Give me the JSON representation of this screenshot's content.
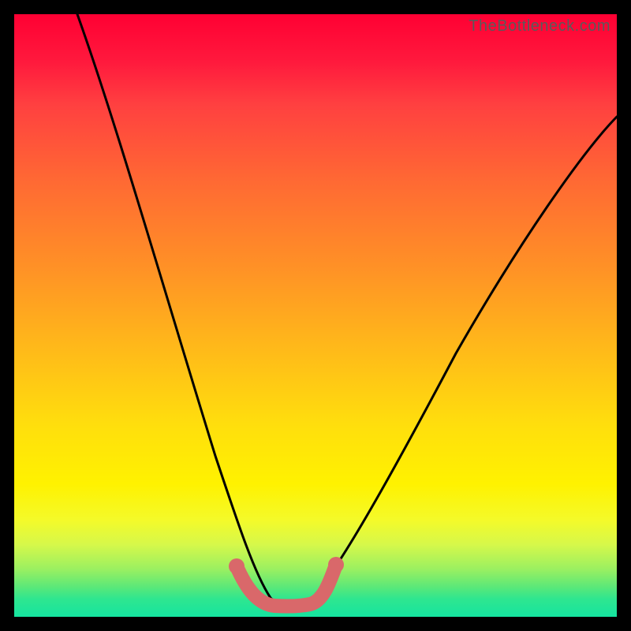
{
  "watermark": "TheBottleneck.com",
  "chart_data": {
    "type": "line",
    "title": "",
    "xlabel": "",
    "ylabel": "",
    "xlim": [
      0,
      100
    ],
    "ylim": [
      0,
      100
    ],
    "series": [
      {
        "name": "bottleneck-curve",
        "x": [
          0,
          6,
          12,
          18,
          24,
          28,
          32,
          35,
          37,
          39,
          41,
          43,
          45,
          47,
          50,
          54,
          58,
          62,
          66,
          72,
          80,
          90,
          100
        ],
        "values": [
          100,
          92,
          82,
          71,
          58,
          47,
          35,
          24,
          15,
          8,
          3,
          1,
          1,
          1,
          3,
          8,
          15,
          23,
          31,
          42,
          55,
          67,
          75
        ]
      },
      {
        "name": "optimal-band",
        "x": [
          37,
          38,
          39,
          40,
          41,
          42,
          43,
          44,
          45,
          46,
          47,
          48,
          49
        ],
        "values": [
          7,
          4,
          2,
          1,
          1,
          1,
          1,
          1,
          1,
          1,
          2,
          4,
          7
        ]
      }
    ],
    "gradient_description": "vertical red-to-green heatmap background; curve dips to green zone near x≈43"
  }
}
